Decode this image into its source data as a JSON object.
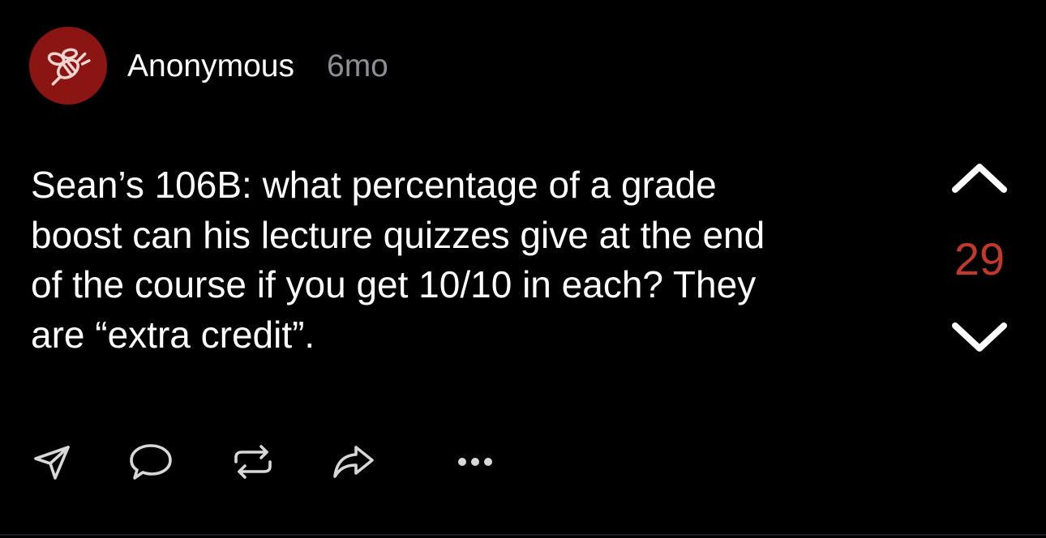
{
  "post": {
    "author": "Anonymous",
    "time": "6mo",
    "text": "Sean’s 106B: what percentage of a grade\nboost can his lecture quizzes give at the end\nof the course if you get 10/10 in each? They\nare “extra credit”.",
    "votes": "29"
  },
  "colors": {
    "background": "#000000",
    "avatar": "#8b1513",
    "vote_count": "#c0392b",
    "muted": "#8e8e93"
  },
  "actions": [
    "send-icon",
    "comment-icon",
    "repost-icon",
    "share-icon",
    "more-icon"
  ]
}
